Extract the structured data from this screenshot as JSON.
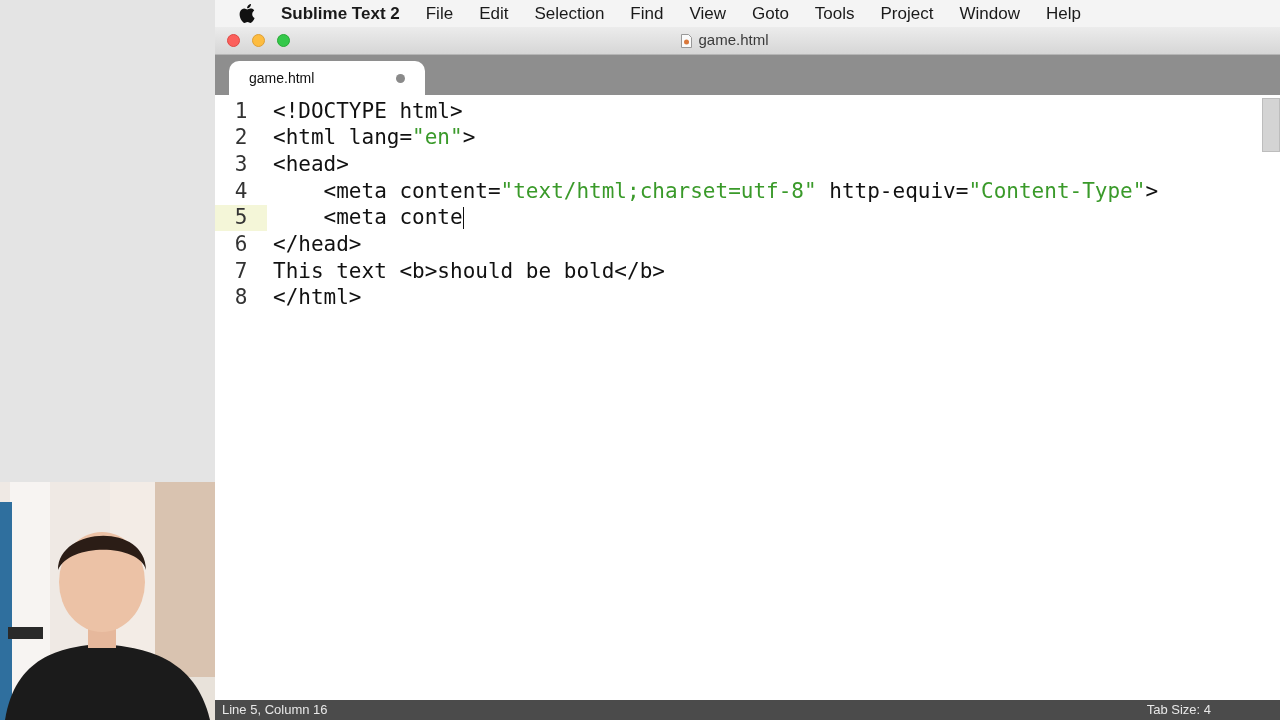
{
  "menu_bar": {
    "app": "Sublime Text 2",
    "items": [
      "File",
      "Edit",
      "Selection",
      "Find",
      "View",
      "Goto",
      "Tools",
      "Project",
      "Window",
      "Help"
    ]
  },
  "window": {
    "title": "game.html"
  },
  "tabs": [
    {
      "label": "game.html",
      "selected": true,
      "modified": true
    }
  ],
  "editor": {
    "lines": [
      {
        "number": "1",
        "current": false,
        "tokens": [
          {
            "kind": "plain",
            "text": "<!DOCTYPE html>"
          }
        ]
      },
      {
        "number": "2",
        "current": false,
        "tokens": [
          {
            "kind": "plain",
            "text": "<html lang="
          },
          {
            "kind": "string",
            "text": "\"en\""
          },
          {
            "kind": "plain",
            "text": ">"
          }
        ]
      },
      {
        "number": "3",
        "current": false,
        "tokens": [
          {
            "kind": "plain",
            "text": "<head>"
          }
        ]
      },
      {
        "number": "4",
        "current": false,
        "tokens": [
          {
            "kind": "plain",
            "text": "    <meta content="
          },
          {
            "kind": "string",
            "text": "\"text/html;charset=utf-8\""
          },
          {
            "kind": "plain",
            "text": " http-equiv="
          },
          {
            "kind": "string",
            "text": "\"Content-Type\""
          },
          {
            "kind": "plain",
            "text": ">"
          }
        ]
      },
      {
        "number": "5",
        "current": true,
        "tokens": [
          {
            "kind": "plain",
            "text": "    <meta conte"
          }
        ]
      },
      {
        "number": "6",
        "current": false,
        "tokens": [
          {
            "kind": "plain",
            "text": "</head>"
          }
        ]
      },
      {
        "number": "7",
        "current": false,
        "tokens": [
          {
            "kind": "plain",
            "text": "This text <b>should be bold</b>"
          }
        ]
      },
      {
        "number": "8",
        "current": false,
        "tokens": [
          {
            "kind": "plain",
            "text": "</html>"
          }
        ]
      }
    ]
  },
  "status_bar": {
    "position": "Line 5, Column 16",
    "tab_size": "Tab Size: 4"
  }
}
